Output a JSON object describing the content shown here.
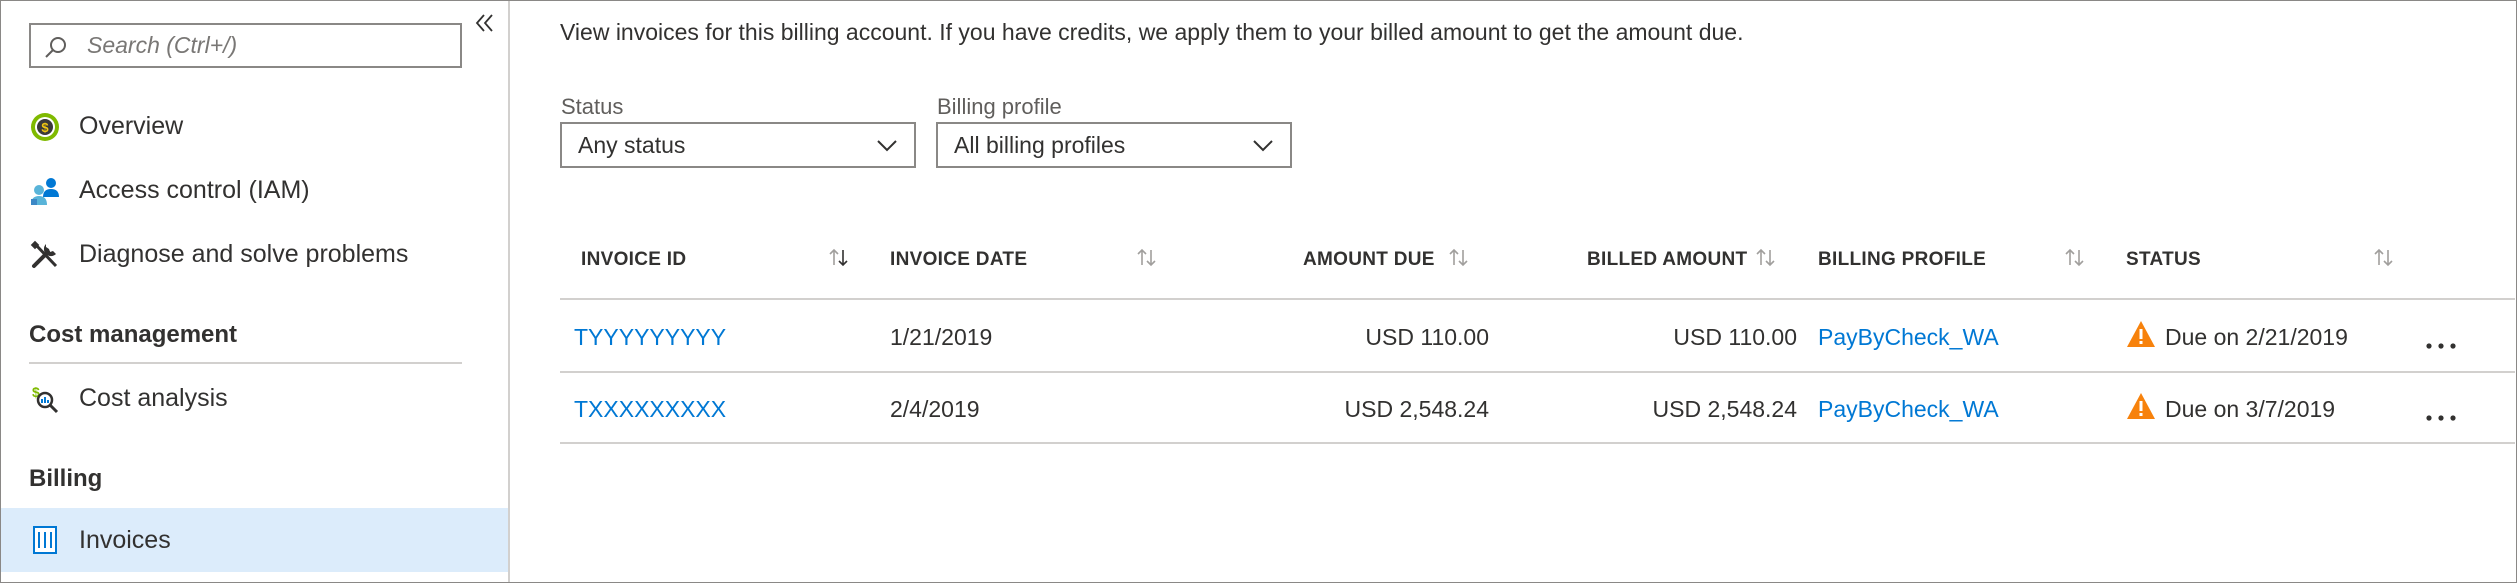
{
  "sidebar": {
    "collapse_icon": "double-chevron-left-icon",
    "search_placeholder": "Search (Ctrl+/)",
    "items": [
      {
        "label": "Overview",
        "icon": "billing-overview-icon"
      },
      {
        "label": "Access control (IAM)",
        "icon": "users-icon"
      },
      {
        "label": "Diagnose and solve problems",
        "icon": "wrench-icon"
      }
    ],
    "sections": [
      {
        "title": "Cost management",
        "items": [
          {
            "label": "Cost analysis",
            "icon": "cost-analysis-icon"
          }
        ]
      },
      {
        "title": "Billing",
        "items": [
          {
            "label": "Invoices",
            "icon": "invoice-icon",
            "active": true
          }
        ]
      }
    ]
  },
  "main": {
    "intro": "View invoices for this billing account. If you have credits, we apply them to your billed amount to get the amount due.",
    "filters": {
      "status": {
        "label": "Status",
        "value": "Any status"
      },
      "billing_profile": {
        "label": "Billing profile",
        "value": "All billing profiles"
      }
    },
    "table": {
      "columns": [
        "INVOICE ID",
        "INVOICE DATE",
        "AMOUNT DUE",
        "BILLED AMOUNT",
        "BILLING PROFILE",
        "STATUS"
      ],
      "rows": [
        {
          "invoice_id": "TYYYYYYYYY",
          "invoice_date": "1/21/2019",
          "amount_due": "USD 110.00",
          "billed_amount": "USD 110.00",
          "billing_profile": "PayByCheck_WA",
          "status": "Due on 2/21/2019"
        },
        {
          "invoice_id": "TXXXXXXXXX",
          "invoice_date": "2/4/2019",
          "amount_due": "USD 2,548.24",
          "billed_amount": "USD 2,548.24",
          "billing_profile": "PayByCheck_WA",
          "status": "Due on 3/7/2019"
        }
      ]
    }
  },
  "colors": {
    "accent": "#0078d4",
    "active_bg": "#dcecfb",
    "warning": "#f7820c",
    "border": "#d2d0ce"
  }
}
